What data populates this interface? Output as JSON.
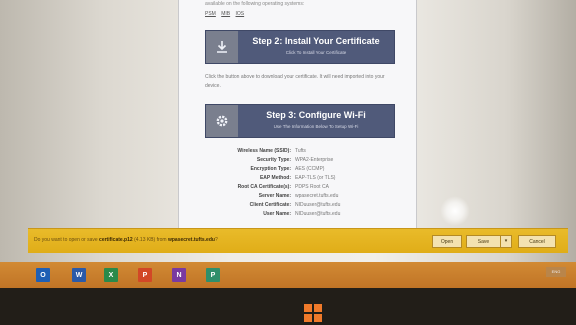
{
  "page": {
    "top_text": "available on the following operating systems:",
    "os_links": [
      "PSM",
      "MIB",
      "IOS"
    ]
  },
  "steps": [
    {
      "title": "Step 2: Install Your Certificate",
      "subtitle": "Click To Install Your Certificate",
      "icon": "download-icon"
    },
    {
      "title": "Step 3: Configure Wi-Fi",
      "subtitle": "Use The Information Below To Setup Wi-Fi",
      "icon": "gear-icon"
    }
  ],
  "instructions": "Click the button above to download your certificate. It will need imported into your device.",
  "wifi_details": [
    {
      "key": "Wireless Name (SSID):",
      "value": "Tufts"
    },
    {
      "key": "Security Type:",
      "value": "WPA2-Enterprise"
    },
    {
      "key": "Encryption Type:",
      "value": "AES (CCMP)"
    },
    {
      "key": "EAP Method:",
      "value": "EAP-TLS (or TLS)"
    },
    {
      "key": "Root CA Certificate(s):",
      "value": "PDPS Root CA"
    },
    {
      "key": "Server Name:",
      "value": "wpasecret.tufts.edu"
    },
    {
      "key": "Client Certificate:",
      "value": "NIDuuser@tufts.edu"
    },
    {
      "key": "User Name:",
      "value": "NIDuuser@tufts.edu"
    }
  ],
  "download_bar": {
    "prefix": "Do you want to open or save",
    "filename": "certificate.p12",
    "size": "(4.13 KB) from",
    "host": "wpasecret.tufts.edu",
    "suffix": "?",
    "open_label": "Open",
    "save_label": "Save",
    "cancel_label": "Cancel"
  },
  "taskbar": {
    "apps": [
      {
        "name": "Outlook",
        "glyph": "O",
        "color": "#1f5fb4"
      },
      {
        "name": "Word",
        "glyph": "W",
        "color": "#2b5aa8"
      },
      {
        "name": "Excel",
        "glyph": "X",
        "color": "#2a8a4a"
      },
      {
        "name": "PowerPoint",
        "glyph": "P",
        "color": "#d24726"
      },
      {
        "name": "OneNote",
        "glyph": "N",
        "color": "#7a3aa0"
      },
      {
        "name": "Publisher",
        "glyph": "P",
        "color": "#2f8f6a"
      }
    ],
    "tray_label": "ENG"
  },
  "colors": {
    "step_button": "#505a7a",
    "notification": "#e5b320",
    "taskbar": "#c98030",
    "windows_logo": "#f07a2a"
  }
}
